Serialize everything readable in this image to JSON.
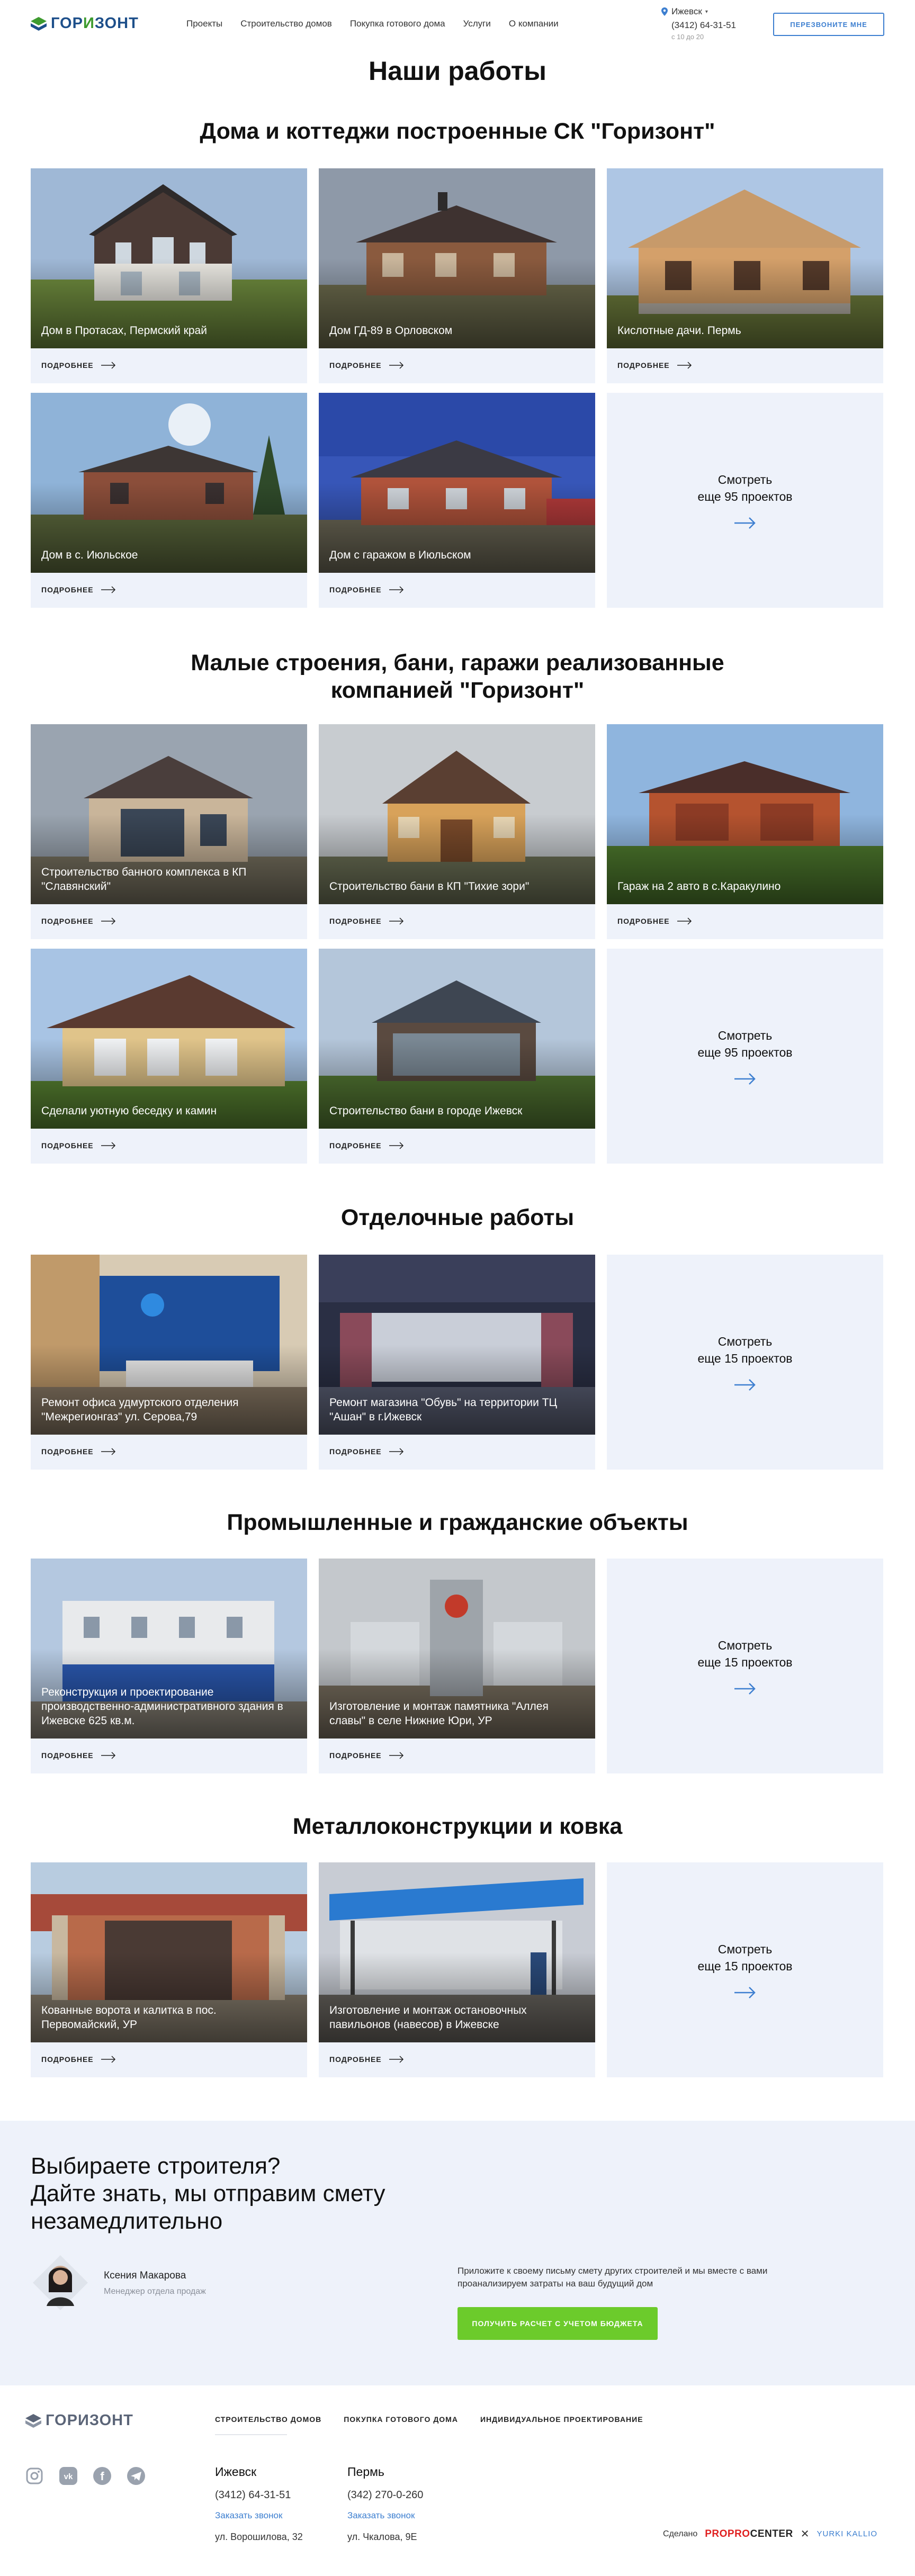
{
  "header": {
    "logo_text_a": "ГОР",
    "logo_text_b": "И",
    "logo_text_c": "ЗОНТ",
    "nav": [
      "Проекты",
      "Строительство домов",
      "Покупка готового дома",
      "Услуги",
      "О компании"
    ],
    "city": "Ижевск",
    "phone": "(3412) 64-31-51",
    "hours": "с 10 до 20",
    "callback_button": "ПЕРЕЗВОНИТЕ МНЕ"
  },
  "page_title": "Наши работы",
  "more_label": "ПОДРОБНЕЕ",
  "sections": [
    {
      "title": "Дома и коттеджи построенные СК \"Горизонт\"",
      "cards": [
        "Дом в Протасах, Пермский край",
        "Дом ГД-89 в Орловском",
        "Кислотные дачи. Пермь",
        "Дом в с. Июльское",
        "Дом с гаражом в Июльском"
      ],
      "more_line1": "Смотреть",
      "more_line2": "еще 95 проектов"
    },
    {
      "title_line1": "Малые строения, бани, гаражи реализованные",
      "title_line2": "компанией \"Горизонт\"",
      "cards": [
        "Строительство банного комплекса в КП \"Славянский\"",
        "Строительство бани в КП \"Тихие зори\"",
        "Гараж на 2 авто в с.Каракулино",
        "Сделали уютную беседку и камин",
        "Строительство бани в городе Ижевск"
      ],
      "more_line1": "Смотреть",
      "more_line2": "еще 95 проектов"
    },
    {
      "title": "Отделочные работы",
      "cards": [
        "Ремонт офиса удмуртского отделения \"Межрегионгаз\" ул. Серова,79",
        "Ремонт магазина \"Обувь\" на территории ТЦ \"Ашан\" в г.Ижевск"
      ],
      "more_line1": "Смотреть",
      "more_line2": "еще 15 проектов"
    },
    {
      "title": "Промышленные и гражданские объекты",
      "cards": [
        "Реконструкция и проектирование производственно-административного здания в Ижевске 625 кв.м.",
        "Изготовление и монтаж памятника \"Аллея славы\" в селе Нижние Юри, УР"
      ],
      "more_line1": "Смотреть",
      "more_line2": "еще 15 проектов"
    },
    {
      "title": "Металлоконструкции и ковка",
      "cards": [
        "Кованные ворота и калитка в пос. Первомайский, УР",
        "Изготовление и монтаж остановочных павильонов (навесов) в Ижевске"
      ],
      "more_line1": "Смотреть",
      "more_line2": "еще 15 проектов"
    }
  ],
  "cta": {
    "title_line1": "Выбираете строителя?",
    "title_line2": "Дайте знать, мы отправим смету",
    "title_line3": "незамедлительно",
    "manager_name": "Ксения Макарова",
    "manager_role": "Менеджер отдела продаж",
    "text": "Приложите к своему письму смету других строителей и мы вместе с вами проанализируем затраты на ваш будущий дом",
    "button": "ПОЛУЧИТЬ РАСЧЕТ С УЧЕТОМ БЮДЖЕТА"
  },
  "footer": {
    "nav": [
      "СТРОИТЕЛЬСТВО ДОМОВ",
      "ПОКУПКА ГОТОВОГО ДОМА",
      "ИНДИВИДУАЛЬНОЕ ПРОЕКТИРОВАНИЕ"
    ],
    "offices": [
      {
        "city": "Ижевск",
        "phone": "(3412) 64-31-51",
        "callback": "Заказать звонок",
        "address": "ул. Ворошилова, 32"
      },
      {
        "city": "Пермь",
        "phone": "(342) 270-0-260",
        "callback": "Заказать звонок",
        "address": "ул. Чкалова, 9Е"
      }
    ],
    "made_by": "Сделано",
    "studio1_a": "PROPRO",
    "studio1_b": "CENTER",
    "studio_sep": "✕",
    "studio2": "YURKI KALLIO"
  },
  "colors": {
    "accent_blue": "#3d7fd0",
    "logo_blue": "#1d4f8a",
    "logo_green": "#3e9b2f",
    "card_bg": "#eef2fa",
    "cta_button": "#6ccb2b"
  },
  "icons": [
    "location-pin-icon",
    "arrow-right-icon",
    "instagram-icon",
    "vk-icon",
    "facebook-icon",
    "telegram-icon"
  ]
}
